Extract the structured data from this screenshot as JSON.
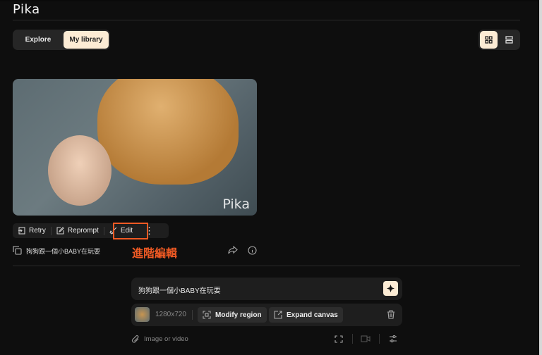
{
  "app": {
    "logo": "Pika"
  },
  "tabs": [
    {
      "label": "Explore",
      "active": false
    },
    {
      "label": "My library",
      "active": true
    }
  ],
  "view_toggle": [
    {
      "icon": "grid-icon",
      "active": true
    },
    {
      "icon": "list-icon",
      "active": false
    }
  ],
  "video": {
    "watermark": "Pika",
    "prompt": "狗狗跟一個小BABY在玩耍"
  },
  "actions": {
    "retry": "Retry",
    "reprompt": "Reprompt",
    "edit": "Edit"
  },
  "annotation": "進階編輯",
  "composer": {
    "prompt": "狗狗跟一個小BABY在玩耍",
    "resolution": "1280x720",
    "modify_region": "Modify region",
    "expand_canvas": "Expand canvas",
    "attach_label": "Image or video"
  },
  "colors": {
    "accent": "#fcecd5",
    "highlight": "#f05a24"
  }
}
